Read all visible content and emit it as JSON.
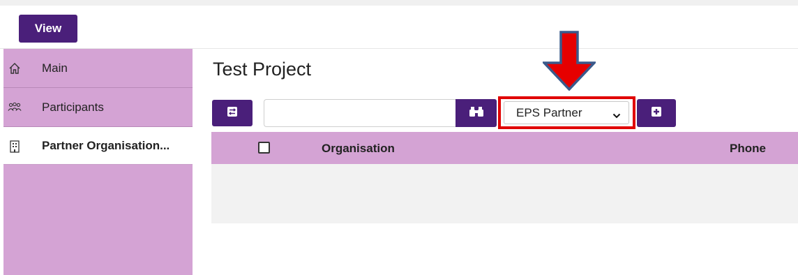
{
  "toolbar": {
    "view_label": "View"
  },
  "sidebar": {
    "items": [
      {
        "label": "Main",
        "icon": "home-icon"
      },
      {
        "label": "Participants",
        "icon": "people-icon"
      },
      {
        "label": "Partner Organisation...",
        "icon": "building-icon",
        "active": true
      }
    ]
  },
  "main": {
    "title": "Test Project",
    "search": {
      "value": "",
      "placeholder": ""
    },
    "type_select": {
      "selected": "EPS Partner"
    },
    "table": {
      "columns": [
        "Organisation",
        "Phone"
      ],
      "rows": []
    }
  },
  "annotation": {
    "arrow_color": "#e60000",
    "arrow_outline": "#3a5a8c",
    "highlight_color": "#e00000"
  },
  "colors": {
    "accent": "#4a1f7a",
    "sidebar_bg": "#d4a3d4",
    "table_header_bg": "#d4a3d4"
  }
}
